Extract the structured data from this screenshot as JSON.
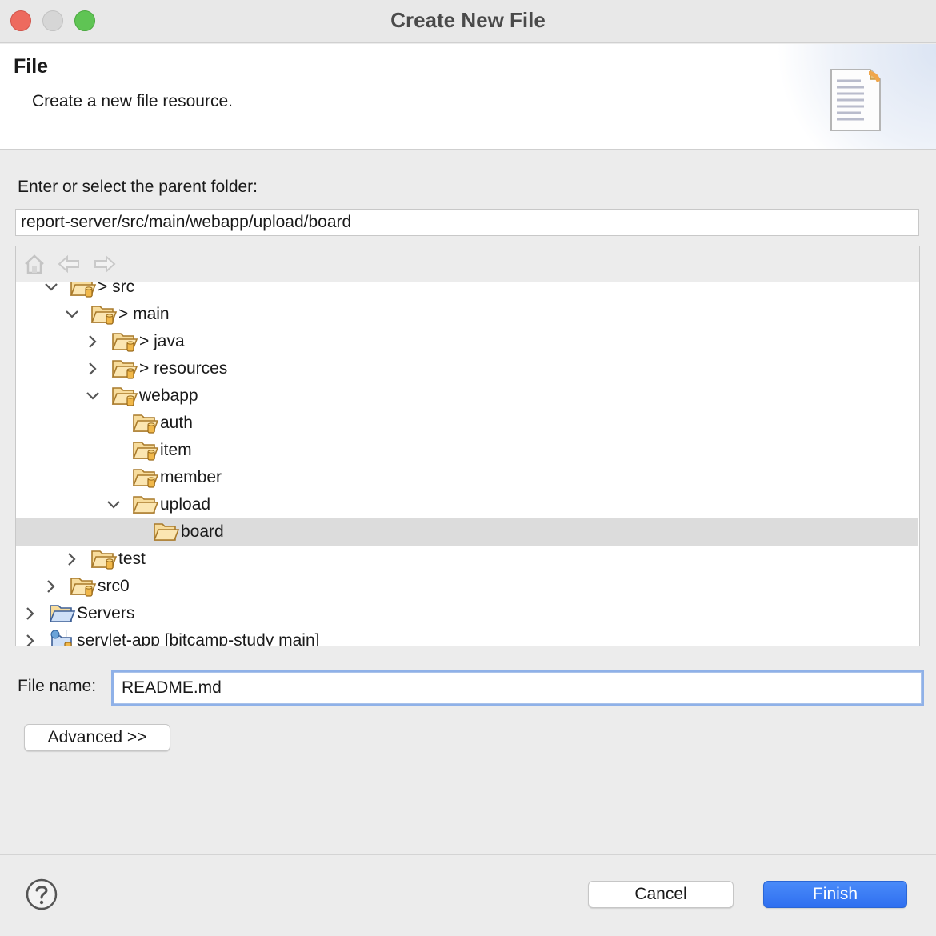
{
  "window": {
    "title": "Create New File"
  },
  "header": {
    "title": "File",
    "description": "Create a new file resource."
  },
  "parent_folder": {
    "label": "Enter or select the parent folder:",
    "value": "report-server/src/main/webapp/upload/board"
  },
  "tree": {
    "toolbar": [
      "home-icon",
      "back-arrow-icon",
      "forward-arrow-icon"
    ],
    "rows": [
      {
        "label": "> src",
        "state": "expanded",
        "icon": "source-folder-icon"
      },
      {
        "label": "> main",
        "state": "expanded",
        "icon": "source-folder-icon"
      },
      {
        "label": "> java",
        "state": "collapsed",
        "icon": "source-folder-icon"
      },
      {
        "label": "> resources",
        "state": "collapsed",
        "icon": "source-folder-icon"
      },
      {
        "label": "webapp",
        "state": "expanded",
        "icon": "source-folder-icon"
      },
      {
        "label": "auth",
        "state": "leaf",
        "icon": "source-folder-icon"
      },
      {
        "label": "item",
        "state": "leaf",
        "icon": "source-folder-icon"
      },
      {
        "label": "member",
        "state": "leaf",
        "icon": "source-folder-icon"
      },
      {
        "label": "upload",
        "state": "expanded",
        "icon": "folder-open-icon"
      },
      {
        "label": "board",
        "state": "leaf",
        "icon": "folder-open-icon",
        "selected": true
      },
      {
        "label": "test",
        "state": "collapsed",
        "icon": "source-folder-icon"
      },
      {
        "label": "src0",
        "state": "collapsed",
        "icon": "source-folder-icon"
      },
      {
        "label": "Servers",
        "state": "collapsed",
        "icon": "servers-folder-icon"
      },
      {
        "label": "servlet-app [bitcamp-study main]",
        "state": "collapsed",
        "icon": "java-project-icon"
      }
    ]
  },
  "file_name": {
    "label": "File name:",
    "value": "README.md"
  },
  "buttons": {
    "advanced": "Advanced >>",
    "cancel": "Cancel",
    "finish": "Finish"
  },
  "colors": {
    "accent": "#3478f6",
    "folder": "#f5d38a",
    "selection": "#dcdcdc"
  }
}
